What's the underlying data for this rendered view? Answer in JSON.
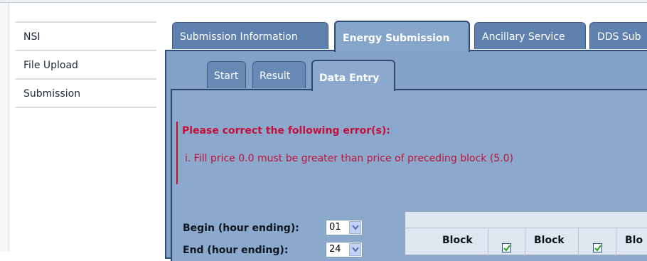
{
  "nav": {
    "items": [
      {
        "label": "NSI"
      },
      {
        "label": "File Upload"
      },
      {
        "label": "Submission"
      }
    ]
  },
  "tabs": [
    {
      "label": "Submission Information",
      "active": false
    },
    {
      "label": "Energy Submission",
      "active": true
    },
    {
      "label": "Ancillary Service",
      "active": false
    },
    {
      "label": "DDS Sub",
      "active": false
    }
  ],
  "subtabs": [
    {
      "label": "Start",
      "active": false
    },
    {
      "label": "Result",
      "active": false
    },
    {
      "label": "Data Entry",
      "active": true
    }
  ],
  "error": {
    "title": "Please correct the following error(s):",
    "items": [
      "i.  Fill price 0.0 must be greater than price of preceding block (5.0)"
    ]
  },
  "form": {
    "begin_label": "Begin (hour ending):",
    "begin_value": "01",
    "end_label": "End (hour ending):",
    "end_value": "24"
  },
  "table": {
    "headers": [
      "Block",
      "Block",
      "Blo"
    ],
    "checkboxes": [
      true,
      true
    ]
  },
  "colors": {
    "tab_bg": "#5f81ad",
    "panel_bg": "#8aa9cd",
    "error_text": "#c4103a",
    "border_dark": "#2c4a73"
  }
}
